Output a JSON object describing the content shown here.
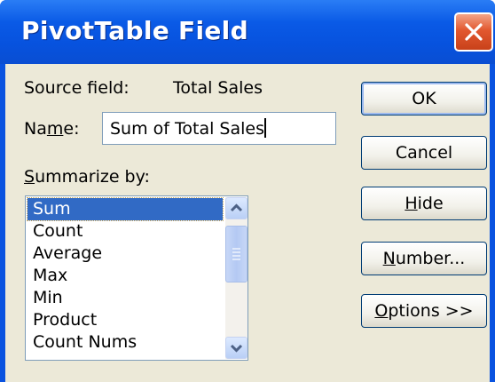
{
  "window": {
    "title": "PivotTable Field"
  },
  "source_field": {
    "label": "Source field:",
    "value": "Total Sales"
  },
  "name_field": {
    "label_prefix": "Na",
    "label_underlined": "m",
    "label_suffix": "e:",
    "value": "Sum of Total Sales"
  },
  "summarize_by": {
    "label_underlined": "S",
    "label_rest": "ummarize by:",
    "items": [
      "Sum",
      "Count",
      "Average",
      "Max",
      "Min",
      "Product",
      "Count Nums"
    ],
    "selected": "Sum"
  },
  "buttons": {
    "ok": {
      "label": "OK"
    },
    "cancel": {
      "label": "Cancel"
    },
    "hide": {
      "underlined": "H",
      "rest": "ide"
    },
    "number": {
      "underlined": "N",
      "rest": "umber..."
    },
    "options": {
      "underlined": "O",
      "rest": "ptions >>"
    }
  },
  "colors": {
    "titlebar": "#0a5ae6",
    "selection": "#316ac5",
    "dialog_bg": "#ece9d8"
  }
}
